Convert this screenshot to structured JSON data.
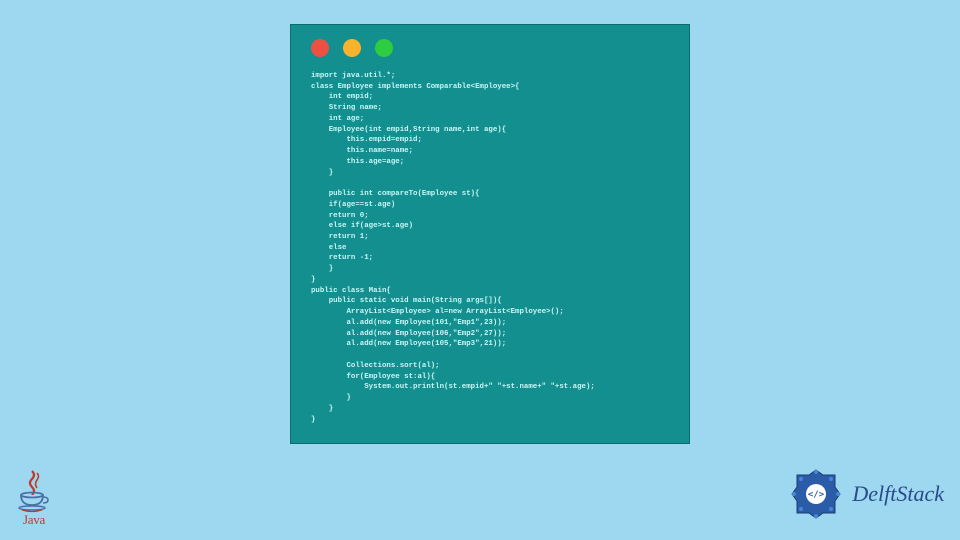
{
  "window": {
    "dots": [
      "red",
      "yellow",
      "green"
    ]
  },
  "code": "import java.util.*;\nclass Employee implements Comparable<Employee>{\n    int empid;\n    String name;\n    int age;\n    Employee(int empid,String name,int age){\n        this.empid=empid;\n        this.name=name;\n        this.age=age;\n    }\n\n    public int compareTo(Employee st){\n    if(age==st.age)\n    return 0;\n    else if(age>st.age)\n    return 1;\n    else\n    return -1;\n    }\n}\npublic class Main{\n    public static void main(String args[]){\n        ArrayList<Employee> al=new ArrayList<Employee>();\n        al.add(new Employee(101,\"Emp1\",23));\n        al.add(new Employee(106,\"Emp2\",27));\n        al.add(new Employee(105,\"Emp3\",21));\n\n        Collections.sort(al);\n        for(Employee st:al){\n            System.out.println(st.empid+\" \"+st.name+\" \"+st.age);\n        }\n    }\n}",
  "logos": {
    "java_label": "Java",
    "delft_label": "DelftStack"
  },
  "colors": {
    "page_bg": "#9ed8f0",
    "window_bg": "#148f8f",
    "code_fg": "#c8f5f5",
    "java_red": "#c0392b",
    "delft_blue": "#2a4a8a"
  }
}
